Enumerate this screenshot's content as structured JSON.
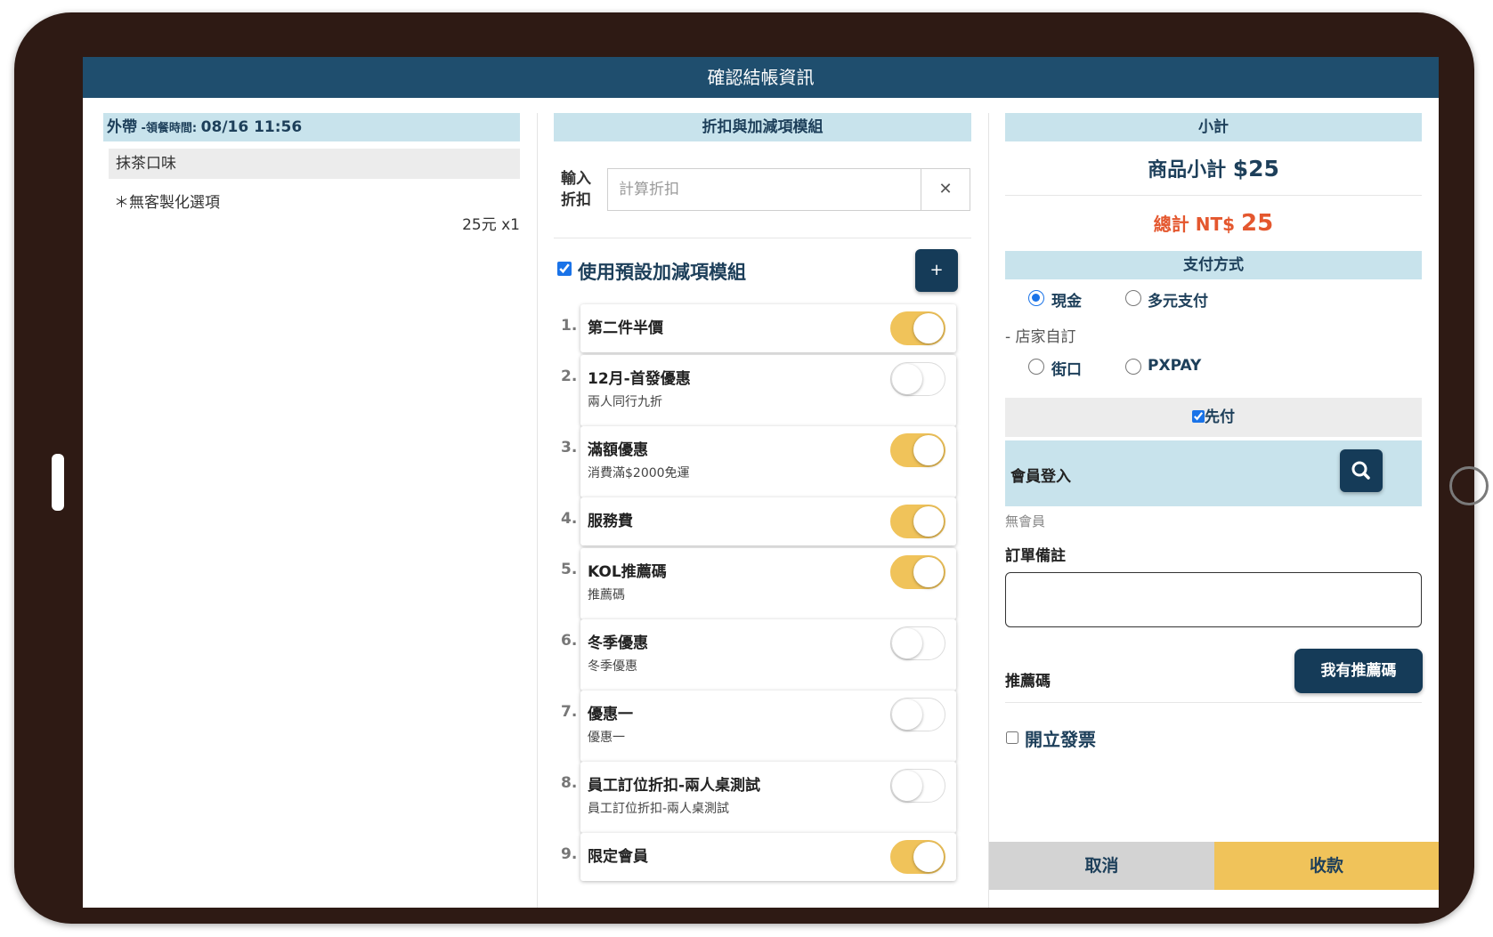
{
  "window": {
    "title": "確認結帳資訊"
  },
  "order": {
    "type": "外帶",
    "pickup_label": " -領餐時間: ",
    "pickup_time": "08/16 11:56",
    "item_name": "抹茶口味",
    "item_option": "＊無客製化選項",
    "item_price": "25元 x1"
  },
  "discount": {
    "header": "折扣與加減項模組",
    "input_label_1": "輸入",
    "input_label_2": "折扣",
    "input_placeholder": "計算折扣",
    "clear_icon": "✕",
    "use_preset_label": "使用預設加減項模組",
    "add_label": "+",
    "modules": [
      {
        "num": "1.",
        "title": "第二件半價",
        "sub": "",
        "on": true
      },
      {
        "num": "2.",
        "title": "12月-首發優惠",
        "sub": "兩人同行九折",
        "on": false
      },
      {
        "num": "3.",
        "title": "滿額優惠",
        "sub": "消費滿$2000免運",
        "on": true
      },
      {
        "num": "4.",
        "title": "服務費",
        "sub": "",
        "on": true
      },
      {
        "num": "5.",
        "title": "KOL推薦碼",
        "sub": "推薦碼",
        "on": true
      },
      {
        "num": "6.",
        "title": "冬季優惠",
        "sub": "冬季優惠",
        "on": false
      },
      {
        "num": "7.",
        "title": "優惠一",
        "sub": "優惠一",
        "on": false
      },
      {
        "num": "8.",
        "title": "員工訂位折扣-兩人桌測試",
        "sub": "員工訂位折扣-兩人桌測試",
        "on": false
      },
      {
        "num": "9.",
        "title": "限定會員",
        "sub": "",
        "on": true
      }
    ]
  },
  "summary": {
    "header": "小計",
    "subtotal_label": "商品小計 ",
    "subtotal_value": "$25",
    "total_label": "總計 NT$ ",
    "total_value": "25",
    "payment_header": "支付方式",
    "pay_cash": "現金",
    "pay_multi": "多元支付",
    "store_custom": "- 店家自訂",
    "pay_jiekou": "街口",
    "pay_pxpay": "PXPAY",
    "prepay_label": "先付",
    "member_login": "會員登入",
    "no_member": "無會員",
    "order_note_label": "訂單備註",
    "referral_label": "推薦碼",
    "referral_button": "我有推薦碼",
    "invoice_label": "開立發票"
  },
  "footer": {
    "cancel": "取消",
    "checkout": "收款"
  },
  "colors": {
    "primary": "#1f4e6e",
    "accent": "#f0c35a",
    "total": "#e4572e",
    "section": "#c8e3ec"
  }
}
